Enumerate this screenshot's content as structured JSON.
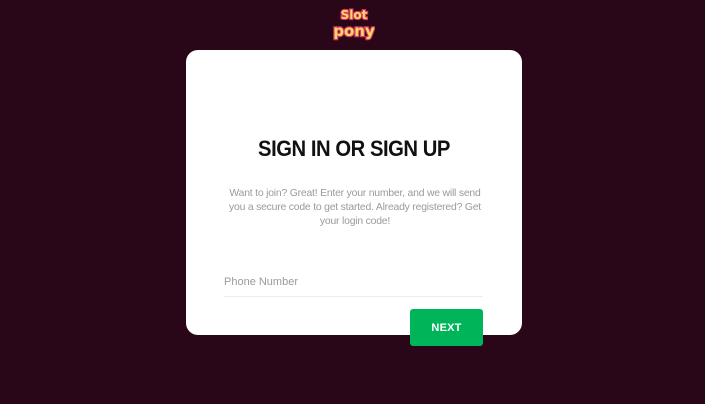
{
  "logo": {
    "line1": "Slot",
    "line2": "pony",
    "colors": {
      "fill": "#fcd66a",
      "outline": "#d63a5c",
      "shadow": "#8e1d3c"
    }
  },
  "card": {
    "title": "SIGN IN OR SIGN UP",
    "subtitle": "Want to join? Great! Enter your number, and we will send you a secure code to get started. Already registered? Get your login code!",
    "phone_field": {
      "placeholder": "Phone Number",
      "value": ""
    },
    "next_label": "NEXT"
  },
  "colors": {
    "background": "#2a0718",
    "card": "#ffffff",
    "accent": "#00b45a"
  }
}
